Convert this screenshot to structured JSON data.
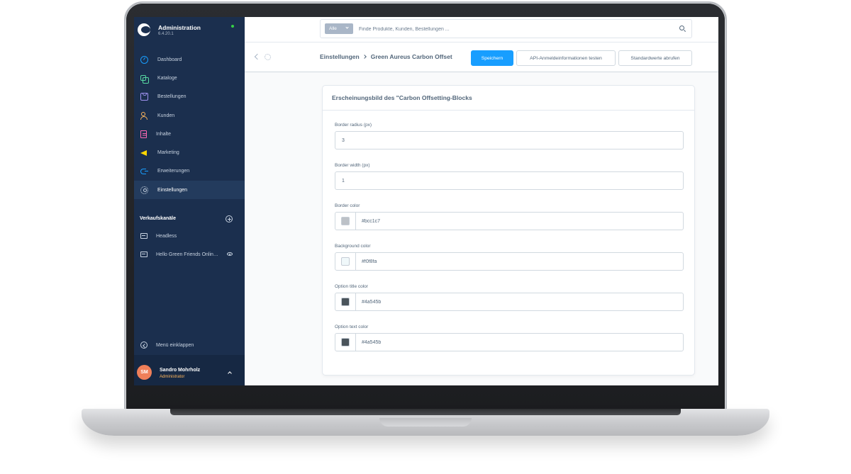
{
  "app": {
    "title": "Administration",
    "version": "6.4.20.1"
  },
  "sidebar": {
    "items": [
      {
        "label": "Dashboard",
        "icon": "dashboard-icon"
      },
      {
        "label": "Kataloge",
        "icon": "catalog-icon"
      },
      {
        "label": "Bestellungen",
        "icon": "orders-icon"
      },
      {
        "label": "Kunden",
        "icon": "customers-icon"
      },
      {
        "label": "Inhalte",
        "icon": "content-icon"
      },
      {
        "label": "Marketing",
        "icon": "marketing-icon"
      },
      {
        "label": "Erweiterungen",
        "icon": "extensions-icon"
      },
      {
        "label": "Einstellungen",
        "icon": "settings-icon",
        "active": true
      }
    ],
    "channels_heading": "Verkaufskanäle",
    "channels": [
      {
        "label": "Headless"
      },
      {
        "label": "Hello Green Friends Onlin…"
      }
    ],
    "collapse_label": "Menü einklappen",
    "user": {
      "initials": "SM",
      "name": "Sandro Mohrholz",
      "role": "Administrator"
    }
  },
  "search": {
    "type_label": "Alle",
    "placeholder": "Finde Produkte, Kunden, Bestellungen ..."
  },
  "smartbar": {
    "breadcrumb_parent": "Einstellungen",
    "breadcrumb_current": "Green Aureus Carbon Offset",
    "save_label": "Speichern",
    "api_test_label": "API-Anmeldeinformationen testen",
    "defaults_label": "Standardwerte abrufen"
  },
  "card": {
    "title": "Erscheinungsbild des \"Carbon Offsetting-Blocks",
    "fields": [
      {
        "label": "Border radius (px)",
        "value": "3"
      },
      {
        "label": "Border width (px)",
        "value": "1"
      },
      {
        "label": "Border color",
        "value": "#bcc1c7",
        "swatch": "#bcc1c7"
      },
      {
        "label": "Background color",
        "value": "#f0f8fa",
        "swatch": "#f0f8fa"
      },
      {
        "label": "Option title color",
        "value": "#4a545b",
        "swatch": "#4a545b"
      },
      {
        "label": "Option text color",
        "value": "#4a545b",
        "swatch": "#4a545b"
      }
    ]
  },
  "colors": {
    "sidebar_bg": "#1b2f4e",
    "primary": "#189eff",
    "text": "#52667a"
  }
}
